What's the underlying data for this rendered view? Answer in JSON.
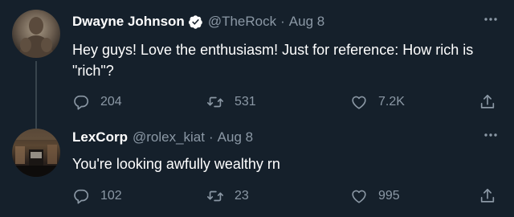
{
  "tweets": [
    {
      "display_name": "Dwayne Johnson",
      "verified": true,
      "handle": "@TheRock",
      "separator": "·",
      "date": "Aug 8",
      "text": "Hey guys! Love the enthusiasm! Just for reference: How rich is \"rich\"?",
      "replies": "204",
      "retweets": "531",
      "likes": "7.2K"
    },
    {
      "display_name": "LexCorp",
      "verified": false,
      "handle": "@rolex_kiat",
      "separator": "·",
      "date": "Aug 8",
      "text": "You're looking awfully wealthy rn",
      "replies": "102",
      "retweets": "23",
      "likes": "995"
    }
  ],
  "icons": {
    "more": "more-horizontal-icon",
    "reply": "reply-icon",
    "retweet": "retweet-icon",
    "like": "heart-icon",
    "share": "share-icon",
    "verified": "verified-badge-icon"
  },
  "colors": {
    "background": "#15202b",
    "text_primary": "#ffffff",
    "text_secondary": "#8b98a5",
    "verified_badge": "#ffffff",
    "thread_line": "#38444d"
  }
}
